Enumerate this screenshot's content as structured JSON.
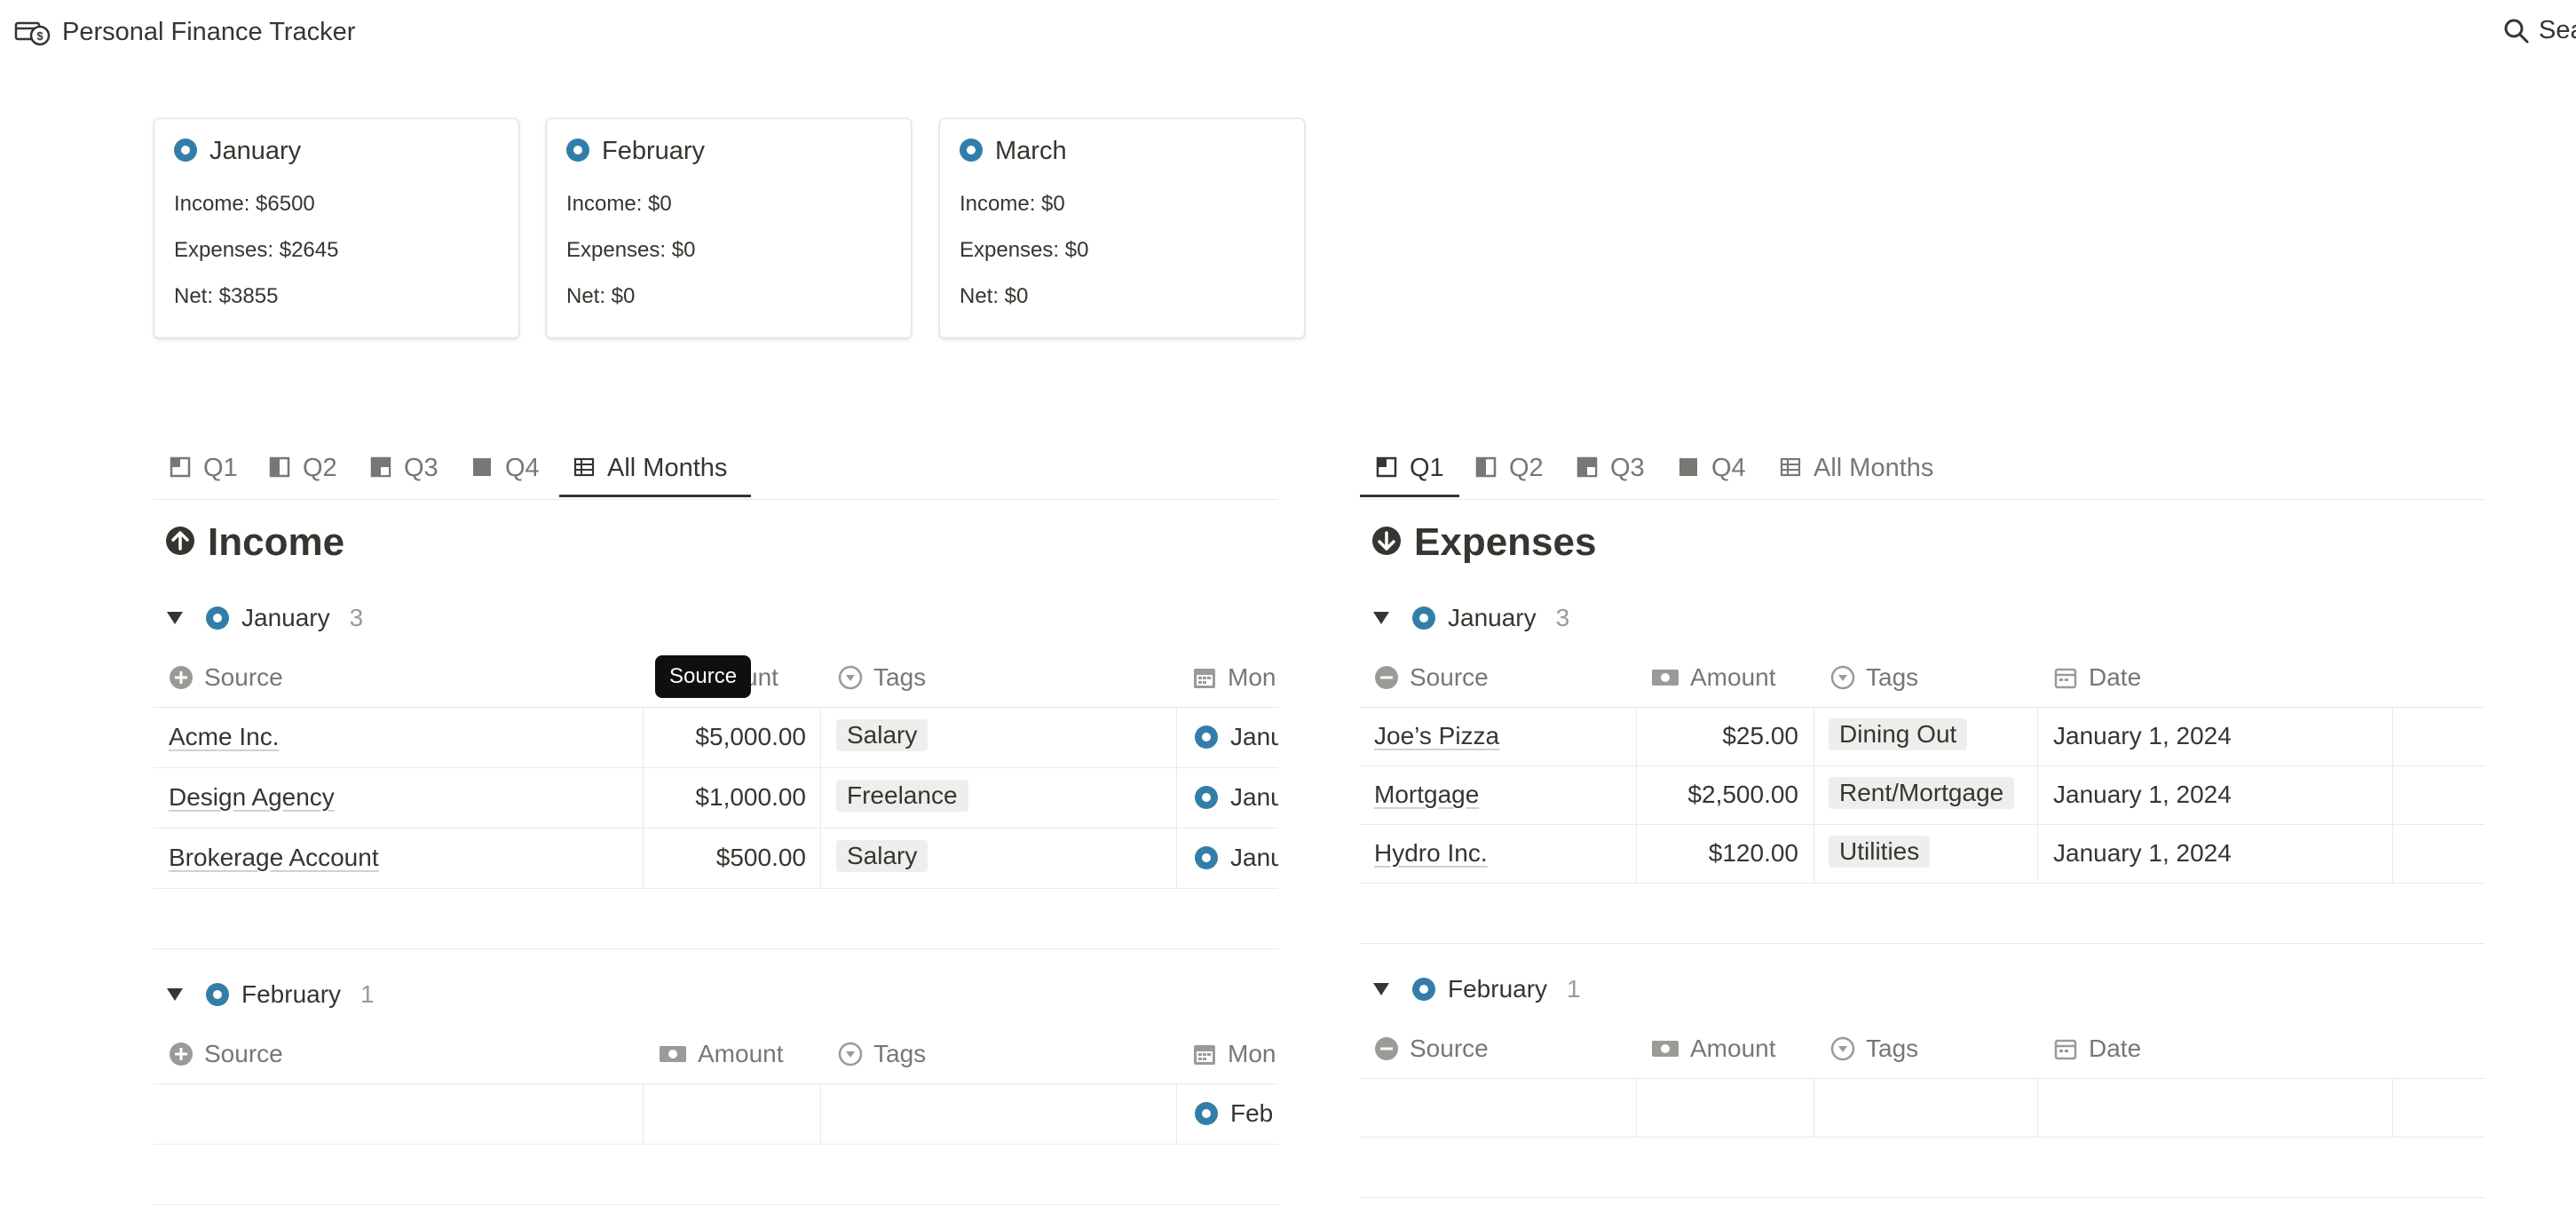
{
  "app": {
    "title": "Personal Finance Tracker",
    "search_label": "Sea"
  },
  "cards": [
    {
      "month": "January",
      "income": "Income: $6500",
      "expenses": "Expenses: $2645",
      "net": "Net: $3855"
    },
    {
      "month": "February",
      "income": "Income: $0",
      "expenses": "Expenses: $0",
      "net": "Net: $0"
    },
    {
      "month": "March",
      "income": "Income: $0",
      "expenses": "Expenses: $0",
      "net": "Net: $0"
    }
  ],
  "income": {
    "tabs": [
      "Q1",
      "Q2",
      "Q3",
      "Q4",
      "All Months"
    ],
    "active_tab": "All Months",
    "heading": "Income",
    "columns": {
      "source": "Source",
      "amount": "Amount",
      "tags": "Tags",
      "month": "Mon"
    },
    "tooltip": "Source",
    "amount_partial": "unt",
    "groups": [
      {
        "name": "January",
        "count": "3",
        "rows": [
          {
            "source": "Acme Inc.",
            "amount": "$5,000.00",
            "tag": "Salary",
            "month": "Janu"
          },
          {
            "source": "Design Agency",
            "amount": "$1,000.00",
            "tag": "Freelance",
            "month": "Janu"
          },
          {
            "source": "Brokerage Account",
            "amount": "$500.00",
            "tag": "Salary",
            "month": "Janu"
          }
        ]
      },
      {
        "name": "February",
        "count": "1",
        "rows": [
          {
            "source": "",
            "amount": "",
            "tag": "",
            "month": "Feb"
          }
        ]
      }
    ]
  },
  "expenses": {
    "tabs": [
      "Q1",
      "Q2",
      "Q3",
      "Q4",
      "All Months"
    ],
    "active_tab": "Q1",
    "heading": "Expenses",
    "columns": {
      "source": "Source",
      "amount": "Amount",
      "tags": "Tags",
      "date": "Date"
    },
    "groups": [
      {
        "name": "January",
        "count": "3",
        "rows": [
          {
            "source": "Joe’s Pizza",
            "amount": "$25.00",
            "tag": "Dining Out",
            "date": "January 1, 2024"
          },
          {
            "source": "Mortgage",
            "amount": "$2,500.00",
            "tag": "Rent/Mortgage",
            "date": "January 1, 2024"
          },
          {
            "source": "Hydro Inc.",
            "amount": "$120.00",
            "tag": "Utilities",
            "date": "January 1, 2024"
          }
        ]
      },
      {
        "name": "February",
        "count": "1",
        "rows": [
          {
            "source": "",
            "amount": "",
            "tag": "",
            "date": ""
          }
        ]
      }
    ]
  },
  "colors": {
    "accent_blue": "#337ea9",
    "text": "#37352f",
    "muted": "#787774",
    "tag_bg": "#eeeeec",
    "tooltip_bg": "#0f0f0f"
  }
}
